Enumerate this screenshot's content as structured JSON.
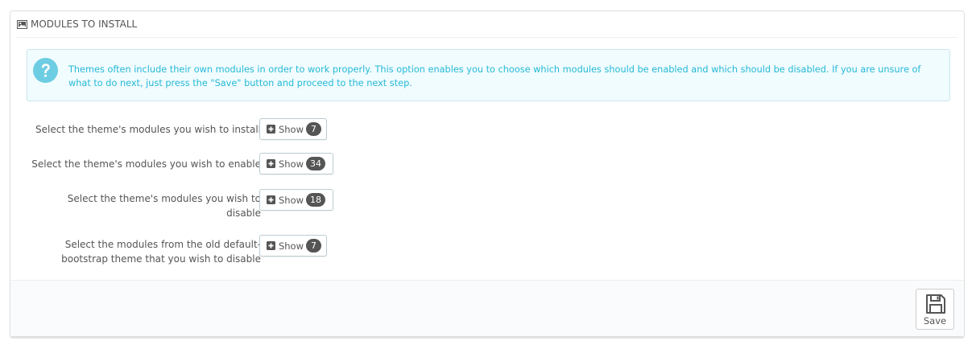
{
  "panel": {
    "title": "MODULES TO INSTALL",
    "title_icon": "picture-icon"
  },
  "alert": {
    "icon": "question-circle-icon",
    "text": "Themes often include their own modules in order to work properly. This option enables you to choose which modules should be enabled and which should be disabled. If you are unsure of what to do next, just press the \"Save\" button and proceed to the next step.",
    "color": "#25b9d7",
    "background": "#f1fcfe"
  },
  "rows": [
    {
      "label": "Select the theme's modules you wish to install",
      "button_label": "Show",
      "count": "7"
    },
    {
      "label": "Select the theme's modules you wish to enable",
      "button_label": "Show",
      "count": "34"
    },
    {
      "label": "Select the theme's modules you wish to disable",
      "button_label": "Show",
      "count": "18"
    },
    {
      "label": "Select the modules from the old default-bootstrap theme that you wish to disable",
      "button_label": "Show",
      "count": "7"
    }
  ],
  "footer": {
    "save_label": "Save",
    "save_icon": "floppy-disk-icon"
  }
}
